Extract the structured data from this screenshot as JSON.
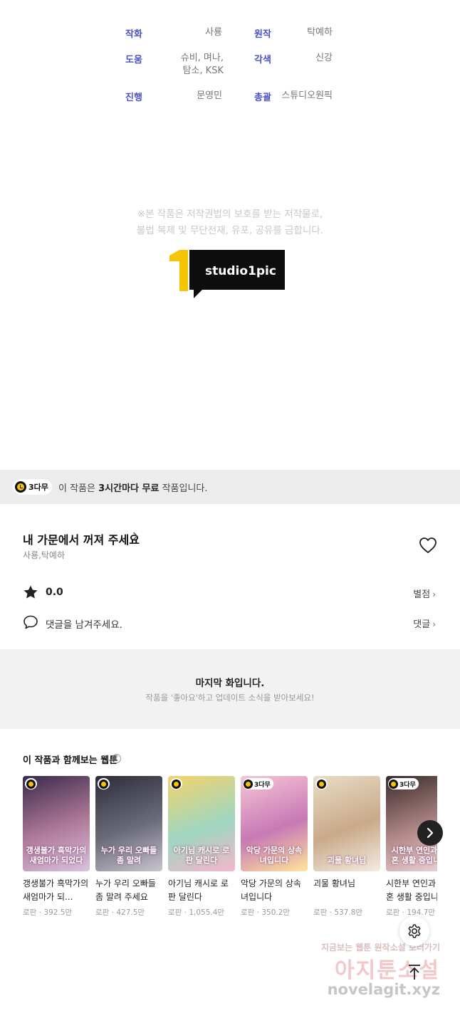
{
  "credits": [
    {
      "label": "작화",
      "value": "사룡"
    },
    {
      "label": "원작",
      "value": "탁예하"
    },
    {
      "label": "도움",
      "value_line1": "슈비, 며나,",
      "value_line2": "탐소, KSK"
    },
    {
      "label": "각색",
      "value": "신강"
    },
    {
      "label": "진행",
      "value": "문영민"
    },
    {
      "label": "총괄",
      "value": "스튜디오원픽"
    }
  ],
  "copyright_notice": {
    "line1": "※본 작품은 저작권법의 보호를 받는 저작물로,",
    "line2": "불법 복제 및 무단전재, 유포, 공유를 금합니다."
  },
  "studio_logo": {
    "number": "1",
    "text": "studio1pic"
  },
  "free_bar": {
    "badge": "3다무",
    "text_prefix": "이 작품은 ",
    "text_bold": "3시간마다 무료",
    "text_suffix": " 작품입니다."
  },
  "series": {
    "title": "내 가문에서 꺼져 주세요",
    "authors": "사룡,탁예하",
    "rating": "0.0",
    "rate_label": "별점",
    "comment_prompt": "댓글을 남겨주세요.",
    "comment_label": "댓글"
  },
  "last_episode": {
    "title": "마지막 화입니다.",
    "subtitle": "작품을 '좋아요'하고 업데이트 소식을 받아보세요!"
  },
  "recommendations": {
    "title": "이 작품과 함께보는 웹툰",
    "help": "?",
    "items": [
      {
        "name": "갱생불가 흑막가의 새엄마가 되...",
        "genre": "로판",
        "views": "392.5만",
        "badge": "",
        "cover_colors": [
          "#3a2a4a",
          "#b07a9a",
          "#d9c3e0"
        ],
        "cover_text": "갱생불가 흑막가의 새엄마가 되었다"
      },
      {
        "name": "누가 우리 오빠들 좀 말려 주세요",
        "genre": "로판",
        "views": "427.5만",
        "badge": "",
        "cover_colors": [
          "#2c2c3a",
          "#6b6b7a",
          "#c9c4cf"
        ],
        "cover_text": "누가 우리 오빠들 좀 말려"
      },
      {
        "name": "아기님 캐시로 로판 달린다",
        "genre": "로판",
        "views": "1,055.4만",
        "badge": "",
        "cover_colors": [
          "#f3d36b",
          "#9fd6c2",
          "#f4b7c8"
        ],
        "cover_text": "아기님 캐시로 로판 달린다"
      },
      {
        "name": "악당 가문의 상속녀입니다",
        "genre": "로판",
        "views": "350.2만",
        "badge": "3다무",
        "cover_colors": [
          "#f7c6d6",
          "#c779b5",
          "#ffe59a"
        ],
        "cover_text": "악당 가문의 상속녀입니다"
      },
      {
        "name": "괴물 황녀님",
        "genre": "로판",
        "views": "537.8만",
        "badge": "",
        "cover_colors": [
          "#e9dcc6",
          "#c9a98a",
          "#f3ece0"
        ],
        "cover_text": "괴물 황녀님"
      },
      {
        "name": "시한부 연인과 이혼 생활 중입니다",
        "genre": "로판",
        "views": "194.7만",
        "badge": "3다무",
        "cover_colors": [
          "#3a2a2a",
          "#b38a8a",
          "#efd7d7"
        ],
        "cover_text": "시한부 연인과 이혼 생활 중입니다"
      }
    ]
  },
  "watermark": {
    "line1": "지금보는 웹툰 원작소설 보러가기",
    "line2": "아지툰소설",
    "line3": "novelagit.xyz"
  },
  "icons": {
    "star": "star-icon",
    "heart": "heart-icon",
    "comment": "speech-bubble-icon",
    "settings": "gear-icon",
    "scroll_top": "arrow-up-icon",
    "next": "chevron-right-icon"
  },
  "colors": {
    "credit_label": "#4a52c4",
    "badge_yellow": "#f6c400",
    "logo_yellow": "#f6c400",
    "logo_black": "#0d0d0d"
  }
}
